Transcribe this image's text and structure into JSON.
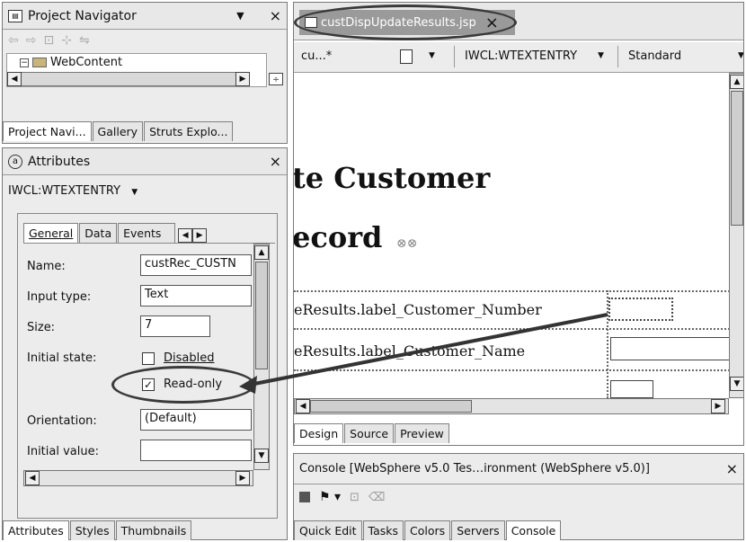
{
  "navigator": {
    "title": "Project Navigator",
    "menu_glyph": "▼",
    "close_glyph": "×",
    "tree_item": "WebContent",
    "tabs": [
      "Project Navi...",
      "Gallery",
      "Struts Explo..."
    ]
  },
  "attributes": {
    "title": "Attributes",
    "close_glyph": "×",
    "tag_select": "IWCL:WTEXTENTRY",
    "tabs": [
      "General",
      "Data",
      "Events"
    ],
    "fields": {
      "name_label": "Name:",
      "name_value": "custRec_CUSTN",
      "input_type_label": "Input type:",
      "input_type_value": "Text",
      "size_label": "Size:",
      "size_value": "7",
      "initial_state_label": "Initial state:",
      "disabled_label": "Disabled",
      "readonly_label": "Read-only",
      "orientation_label": "Orientation:",
      "orientation_value": "(Default)",
      "initial_value_label": "Initial value:",
      "initial_value_value": ""
    },
    "bottom_tabs": [
      "Attributes",
      "Styles",
      "Thumbnails"
    ]
  },
  "editor": {
    "tab_title": "custDispUpdateResults.jsp",
    "toolbar": {
      "cu": "cu...*",
      "tag": "IWCL:WTEXTENTRY",
      "mode": "Standard"
    },
    "heading_line1": "te Customer",
    "heading_line2": "ecord",
    "row1_label": "eResults.label_Customer_Number",
    "row2_label": "eResults.label_Customer_Name",
    "bottom_tabs": [
      "Design",
      "Source",
      "Preview"
    ]
  },
  "console": {
    "title": "Console [WebSphere v5.0 Tes…ironment (WebSphere v5.0)]",
    "close_glyph": "×",
    "tabs": [
      "Quick Edit",
      "Tasks",
      "Colors",
      "Servers",
      "Console"
    ]
  }
}
